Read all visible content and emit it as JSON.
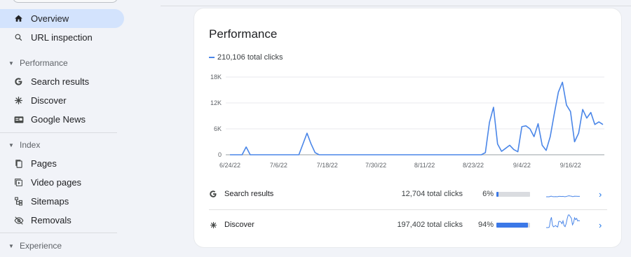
{
  "sidebar": {
    "items": [
      {
        "label": "Overview",
        "icon": "home-icon"
      },
      {
        "label": "URL inspection",
        "icon": "search-icon"
      }
    ],
    "sections": [
      {
        "label": "Performance",
        "items": [
          {
            "label": "Search results",
            "icon": "google-g-icon"
          },
          {
            "label": "Discover",
            "icon": "asterisk-icon"
          },
          {
            "label": "Google News",
            "icon": "news-icon"
          }
        ]
      },
      {
        "label": "Index",
        "items": [
          {
            "label": "Pages",
            "icon": "pages-icon"
          },
          {
            "label": "Video pages",
            "icon": "video-pages-icon"
          },
          {
            "label": "Sitemaps",
            "icon": "sitemap-icon"
          },
          {
            "label": "Removals",
            "icon": "removals-icon"
          }
        ]
      },
      {
        "label": "Experience"
      }
    ]
  },
  "card": {
    "title": "Performance",
    "legend": "210,106 total clicks",
    "accent": "#4a86e8"
  },
  "chart_data": {
    "type": "line",
    "ylim": [
      0,
      18000
    ],
    "y_ticks": [
      "0",
      "6K",
      "12K",
      "18K"
    ],
    "x_tick_labels": [
      "6/24/22",
      "7/6/22",
      "7/18/22",
      "7/30/22",
      "8/11/22",
      "8/23/22",
      "9/4/22",
      "9/16/22"
    ],
    "x_start": "6/24/22",
    "series": [
      {
        "values": [
          0,
          0,
          0,
          0,
          1800,
          0,
          0,
          0,
          0,
          0,
          0,
          0,
          0,
          0,
          0,
          0,
          0,
          0,
          2500,
          5000,
          2500,
          500,
          0,
          0,
          0,
          0,
          0,
          0,
          0,
          0,
          0,
          0,
          0,
          0,
          0,
          0,
          0,
          0,
          0,
          0,
          0,
          0,
          0,
          0,
          0,
          0,
          0,
          0,
          0,
          0,
          0,
          0,
          0,
          0,
          0,
          0,
          0,
          0,
          0,
          0,
          0,
          0,
          0,
          500,
          7500,
          11000,
          2500,
          800,
          1500,
          2200,
          1200,
          700,
          6500,
          6700,
          6000,
          4200,
          7200,
          2200,
          1000,
          4200,
          9500,
          14500,
          16800,
          11500,
          10000,
          3000,
          5000,
          10500,
          8500,
          9800,
          7000,
          7600,
          7000
        ]
      }
    ]
  },
  "rows": [
    {
      "icon": "google-g-icon",
      "name": "Search results",
      "clicks": "12,704 total clicks",
      "pct": "6%",
      "pct_value": 6
    },
    {
      "icon": "asterisk-icon",
      "name": "Discover",
      "clicks": "197,402 total clicks",
      "pct": "94%",
      "pct_value": 94
    }
  ]
}
